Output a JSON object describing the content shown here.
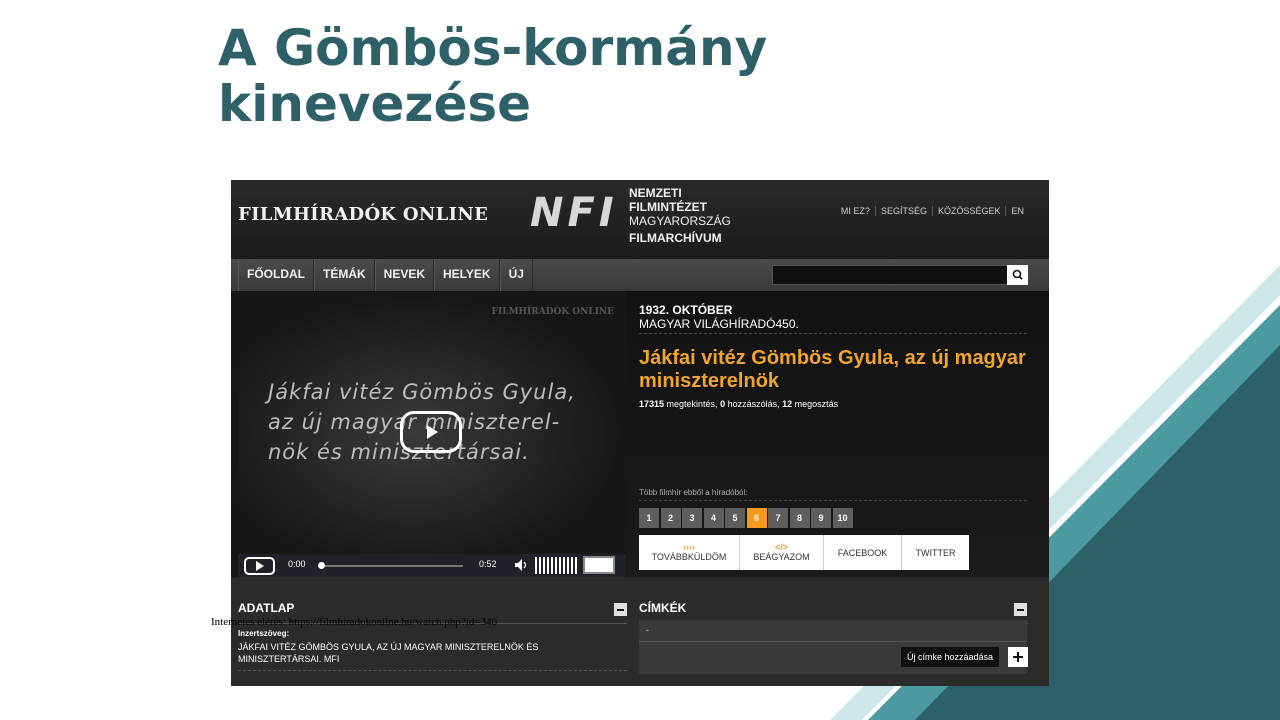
{
  "slide": {
    "title_line1": "A Gömbös-kormány",
    "title_line2": "kinevezése",
    "source_note": "Internetes elérés: https://filmhiradokonline.hu/watch.php?id=346",
    "accent_colors": [
      "#2e6068",
      "#4a9aa0",
      "#cde6e8"
    ]
  },
  "site": {
    "logo": "FILMHÍRADÓK ONLINE",
    "nfi_mark": "NFI",
    "nfi_lines": [
      "NEMZETI",
      "FILMINTÉZET",
      "MAGYARORSZÁG",
      "FILMARCHÍVUM"
    ],
    "top_links": [
      "MI EZ?",
      "SEGÍTSÉG",
      "KÖZÖSSÉGEK",
      "EN"
    ],
    "nav": [
      "FŐOLDAL",
      "TÉMÁK",
      "NEVEK",
      "HELYEK",
      "ÚJ"
    ],
    "search_placeholder": ""
  },
  "video": {
    "watermark": "FILMHÍRADÓK ONLINE",
    "caption_lines": [
      "Jákfai vitéz Gömbös Gyula,",
      "az új magyar miniszterel-",
      "nök és minisztertársai."
    ],
    "current_time": "0:00",
    "duration": "0:52",
    "progress": 0
  },
  "info": {
    "date": "1932. OKTÓBER",
    "issue": "MAGYAR VILÁGHÍRADÓ450.",
    "headline": "Jákfai vitéz Gömbös Gyula, az új magyar miniszterelnök",
    "views": "17315",
    "views_label": " megtekintés, ",
    "comments": "0",
    "comments_label": " hozzászólás, ",
    "shares": "12",
    "shares_label": " megosztás",
    "more_label": "Több filmhír ebből a híradóból:",
    "pages": [
      "1",
      "2",
      "3",
      "4",
      "5",
      "6",
      "7",
      "8",
      "9",
      "10"
    ],
    "active_page": "6",
    "share_buttons": [
      "TOVÁBBKÜLDÖM",
      "BEÁGYAZOM",
      "FACEBOOK",
      "TWITTER"
    ]
  },
  "adatlap": {
    "title": "ADATLAP",
    "label": "Inzertszöveg:",
    "text": "JÁKFAI VITÉZ GÖMBÖS GYULA, AZ ÚJ MAGYAR MINISZTERELNÖK ÉS MINISZTERTÁRSAI. MFI"
  },
  "cimkek": {
    "title": "CÍMKÉK",
    "placeholder_tag": "-",
    "add_label": "Új címke hozzáadása"
  }
}
